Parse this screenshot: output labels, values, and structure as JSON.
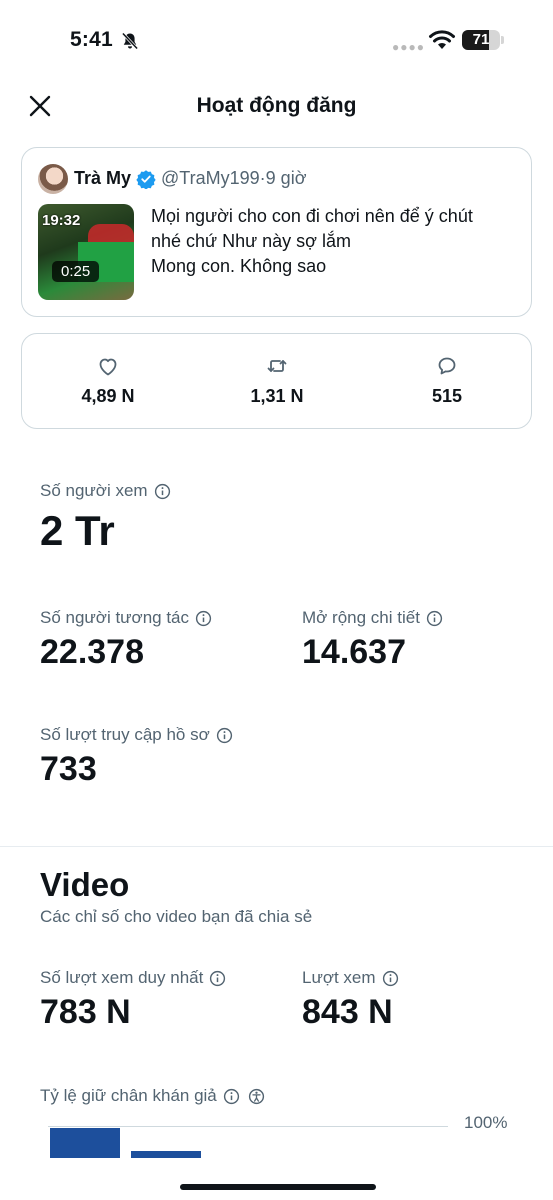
{
  "status_bar": {
    "time": "5:41",
    "battery_level": "71",
    "icons": [
      "bell-slash-icon",
      "signal-dots-icon",
      "wifi-icon",
      "battery-icon"
    ]
  },
  "header": {
    "title": "Hoạt động đăng",
    "close_icon": "close-icon"
  },
  "post": {
    "author_name": "Trà My",
    "handle": "@TraMy199",
    "time_ago": "9 giờ",
    "separator": " · ",
    "thumbnail_clock": "19:32",
    "video_duration": "0:25",
    "text_lines": [
      "Mọi người cho con đi chơi nên để ý chút",
      "nhé chứ Như này sợ lắm",
      "Mong con. Không sao"
    ]
  },
  "engagement": {
    "likes": "4,89 N",
    "reposts": "1,31 N",
    "replies": "515"
  },
  "stats": {
    "impressions_label": "Số người xem",
    "impressions_value": "2 Tr",
    "engagements_label": "Số người tương tác",
    "engagements_value": "22.378",
    "detail_expands_label": "Mở rộng chi tiết",
    "detail_expands_value": "14.637",
    "profile_visits_label": "Số lượt truy cập hồ sơ",
    "profile_visits_value": "733"
  },
  "video": {
    "title": "Video",
    "subtitle": "Các chỉ số cho video bạn đã chia sẻ",
    "unique_views_label": "Số lượt xem duy nhất",
    "unique_views_value": "783 N",
    "views_label": "Lượt xem",
    "views_value": "843 N",
    "retention_label": "Tỷ lệ giữ chân khán giả",
    "retention_axis_max": "100%"
  },
  "chart_data": {
    "type": "bar",
    "title": "Tỷ lệ giữ chân khán giả",
    "ylim": [
      0,
      100
    ],
    "values": [
      95,
      21
    ],
    "color": "#1d4f9c"
  },
  "colors": {
    "text_primary": "#0f1419",
    "text_secondary": "#536471",
    "border": "#cfd9de",
    "verified_blue": "#1d9bf0",
    "bar_blue": "#1d4f9c"
  }
}
